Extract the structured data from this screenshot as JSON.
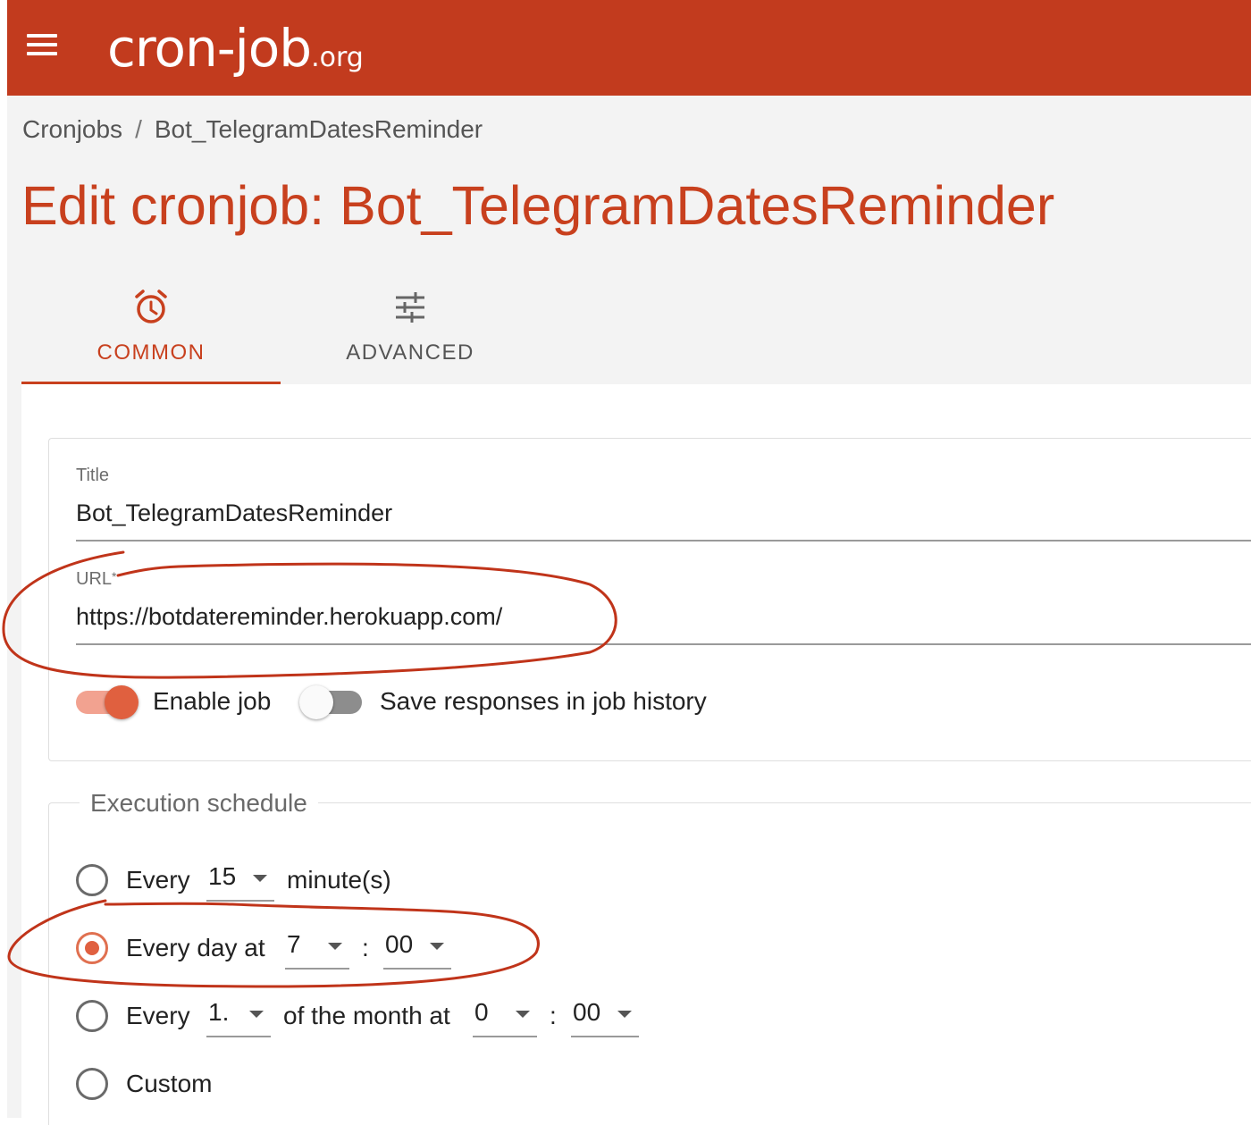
{
  "header": {
    "logo_main": "cron-job",
    "logo_tld": ".org"
  },
  "breadcrumb": {
    "root": "Cronjobs",
    "separator": "/",
    "current": "Bot_TelegramDatesReminder"
  },
  "page": {
    "title": "Edit cronjob: Bot_TelegramDatesReminder"
  },
  "tabs": [
    {
      "label": "COMMON",
      "icon": "alarm-clock-icon",
      "active": true
    },
    {
      "label": "ADVANCED",
      "icon": "sliders-icon",
      "active": false
    }
  ],
  "form": {
    "title_label": "Title",
    "title_value": "Bot_TelegramDatesReminder",
    "url_label": "URL",
    "url_required_mark": "*",
    "url_value": "https://botdatereminder.herokuapp.com/",
    "enable_job_label": "Enable job",
    "enable_job_on": true,
    "save_responses_label": "Save responses in job history",
    "save_responses_on": false
  },
  "schedule": {
    "legend": "Execution schedule",
    "option1": {
      "prefix": "Every",
      "value": "15",
      "suffix": "minute(s)",
      "checked": false
    },
    "option2": {
      "prefix": "Every day at",
      "hour": "7",
      "colon": ":",
      "minute": "00",
      "checked": true
    },
    "option3": {
      "prefix": "Every",
      "day": "1.",
      "middle": "of the month at",
      "hour": "0",
      "colon": ":",
      "minute": "00",
      "checked": false
    },
    "option4": {
      "label": "Custom",
      "checked": false
    }
  },
  "colors": {
    "brand": "#c23b1e",
    "accent": "#c8401e",
    "annotation": "#c0341a"
  }
}
